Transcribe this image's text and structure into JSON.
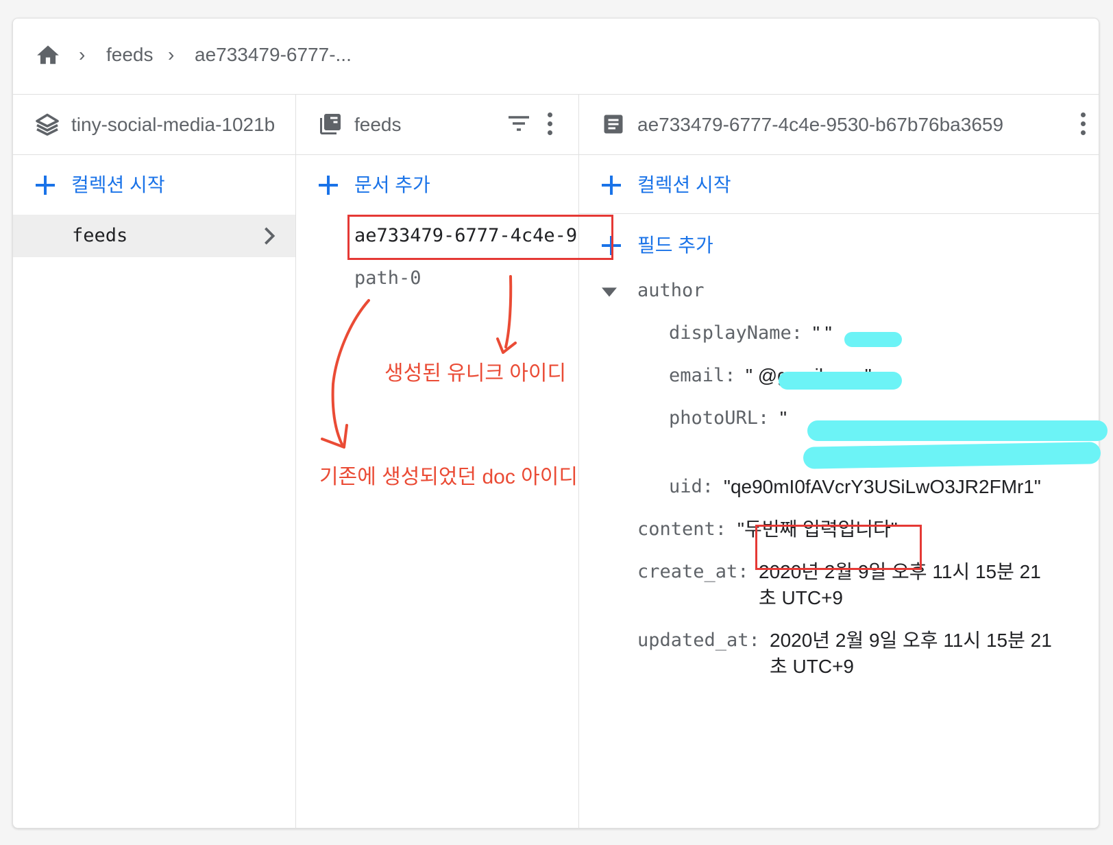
{
  "breadcrumb": {
    "home_icon": "home-icon",
    "items": [
      "feeds",
      "ae733479-6777-..."
    ]
  },
  "columns": {
    "root": {
      "title": "tiny-social-media-1021b",
      "action": "컬렉션 시작",
      "items": [
        {
          "label": "feeds",
          "selected": true
        }
      ]
    },
    "collection": {
      "title": "feeds",
      "action": "문서 추가",
      "items": [
        {
          "label": "ae733479-6777-4c4e-9",
          "selected": true
        },
        {
          "label": "path-0",
          "selected": false
        }
      ]
    },
    "document": {
      "title": "ae733479-6777-4c4e-9530-b67b76ba3659",
      "start_collection": "컬렉션 시작",
      "add_field": "필드 추가",
      "fields": {
        "author_key": "author",
        "author": [
          {
            "key": "displayName:",
            "value": "\"  \""
          },
          {
            "key": "email:",
            "value": "\"            @gmail.com\""
          },
          {
            "key": "photoURL:",
            "value": "\""
          },
          {
            "key": "uid:",
            "value": "\"qe90mI0fAVcrY3USiLwO3JR2FMr1\""
          }
        ],
        "content_key": "content:",
        "content_value": "\"두번째 입력입니다\"",
        "create_key": "create_at:",
        "create_value_1": "2020년 2월 9일 오후 11시 15분 21",
        "create_value_2": "초 UTC+9",
        "updated_key": "updated_at:",
        "updated_value_1": "2020년 2월 9일 오후 11시 15분 21",
        "updated_value_2": "초 UTC+9"
      }
    }
  },
  "annotations": {
    "unique_id": "생성된 유니크 아이디",
    "existing_id": "기존에 생성되었던 doc 아이디"
  },
  "colors": {
    "accent": "#1a73e8",
    "annotation": "#ea4b35",
    "redaction": "#6cf3f6"
  }
}
